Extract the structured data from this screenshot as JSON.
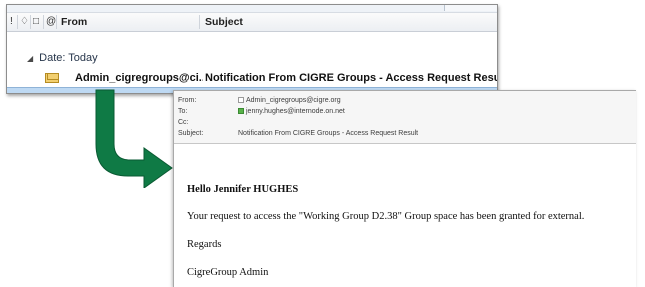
{
  "inbox": {
    "columns": {
      "flag": "!",
      "from": "From",
      "subject": "Subject"
    },
    "group_label": "Date: Today",
    "rows": [
      {
        "from": "Admin_cigregroups@ci...",
        "subject": "Notification From CIGRE Groups - Access Request Result"
      }
    ],
    "selected_row_color": "#bed9f3"
  },
  "message": {
    "from_label": "From:",
    "from_value": "Admin_cigregroups@cigre.org",
    "to_label": "To:",
    "to_value": "jenny.hughes@internode.on.net",
    "cc_label": "Cc:",
    "cc_value": "",
    "subject_label": "Subject:",
    "subject_value": "Notification From CIGRE Groups - Access Request Result",
    "greeting": "Hello Jennifer HUGHES",
    "body_line": "Your request to access the \"Working Group D2.38\" Group space has been granted for external.",
    "regards": "Regards",
    "signature": "CigreGroup Admin"
  },
  "colors": {
    "arrow": "#0f7a45",
    "arrow_edge": "#0a5a33"
  }
}
